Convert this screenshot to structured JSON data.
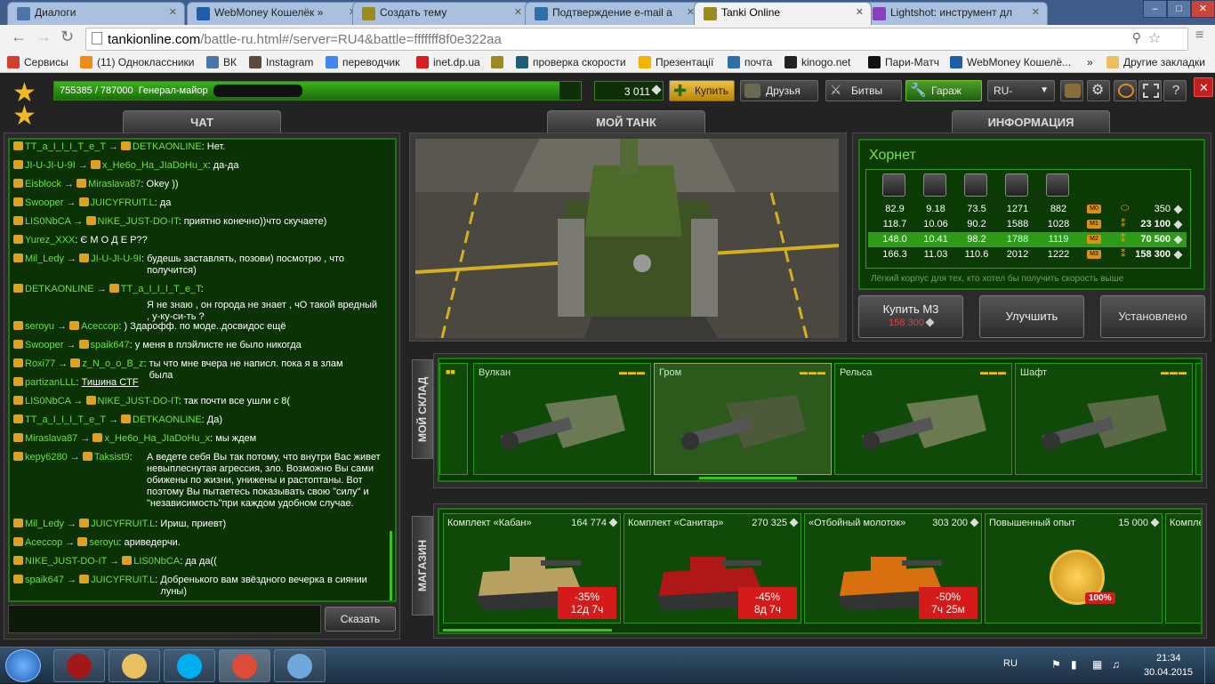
{
  "browser": {
    "tabs": [
      {
        "label": "Диалоги",
        "icon": "vk-icon",
        "color": "#4a76a8",
        "active": false
      },
      {
        "label": "WebMoney Кошелёк »",
        "icon": "webmoney-icon",
        "color": "#1e5ea8",
        "active": false
      },
      {
        "label": "Создать тему",
        "icon": "tanki-icon",
        "color": "#9a8a20",
        "active": false
      },
      {
        "label": "Подтверждение e-mail а",
        "icon": "mail-icon",
        "color": "#2f6fa8",
        "active": false
      },
      {
        "label": "Tanki Online",
        "icon": "tanki-icon",
        "color": "#9a8a20",
        "active": true
      },
      {
        "label": "Lightshot: инструмент дл",
        "icon": "lightshot-icon",
        "color": "#8a3fc0",
        "active": false
      }
    ],
    "url_prefix": "tankionline.com",
    "url_rest": "/battle-ru.html#/server=RU4&battle=fffffff8f0e322aa",
    "bookmarks": [
      {
        "label": "Сервисы",
        "icon": "apps-icon",
        "color": "#d23f31"
      },
      {
        "label": "(11) Одноклассники",
        "icon": "ok-icon",
        "color": "#f08a18"
      },
      {
        "label": "ВК",
        "icon": "vk-icon",
        "color": "#4a76a8"
      },
      {
        "label": "Instagram",
        "icon": "instagram-icon",
        "color": "#5b4a3a"
      },
      {
        "label": "переводчик",
        "icon": "translate-icon",
        "color": "#4285f4"
      },
      {
        "label": "inet.dp.ua",
        "icon": "star-icon",
        "color": "#d81e1e"
      },
      {
        "label": "",
        "icon": "tanki-icon",
        "color": "#9a8a20"
      },
      {
        "label": "проверка скорости",
        "icon": "speedtest-icon",
        "color": "#1e5e7a"
      },
      {
        "label": "Презентації",
        "icon": "slides-icon",
        "color": "#f2b400"
      },
      {
        "label": "почта",
        "icon": "mail-icon",
        "color": "#2f6fa8"
      },
      {
        "label": "kinogo.net",
        "icon": "kinogo-icon",
        "color": "#222222"
      },
      {
        "label": "Пари-Матч",
        "icon": "parimatch-icon",
        "color": "#111111"
      },
      {
        "label": "WebMoney Кошелё...",
        "icon": "webmoney-icon",
        "color": "#1e5ea8"
      },
      {
        "label": "»",
        "icon": "",
        "color": ""
      },
      {
        "label": "Другие закладки",
        "icon": "folder-icon",
        "color": "#e8c060"
      }
    ]
  },
  "game": {
    "top": {
      "progress_text": "755385 / 787000  Генерал-майор",
      "progress_fraction": 0.96,
      "crystals": "3 011",
      "buy_label": "Купить",
      "friends_label": "Друзья",
      "battles_label": "Битвы",
      "garage_label": "Гараж",
      "lang": "RU-"
    },
    "chat": {
      "title": "ЧАТ",
      "send_label": "Сказать",
      "messages": [
        {
          "from": "TT_a_I_I_I_T_e_T",
          "to": "DETKAONLINE",
          "text": "Нет."
        },
        {
          "from": "JI-U-JI-U-9I",
          "to": "x_He6o_Ha_JIaDoHu_x",
          "text": "да-да"
        },
        {
          "from": "Eisblock",
          "to": "Miraslava87",
          "text": "Okey ))"
        },
        {
          "from": "Swooper",
          "to": "JUICYFRUIT.L",
          "text": "да"
        },
        {
          "from": "LIS0NbCA",
          "to": "NIKE_JUST-DO-IT",
          "text": "приятно конечно))что скучаете)"
        },
        {
          "from": "Yurez_XXX",
          "to": "",
          "text": "Є М О Д Е Р??"
        },
        {
          "from": "Mil_Ledy",
          "to": "JI-U-JI-U-9I",
          "text": "будешь заставлять, позови) посмотрю , что получится)"
        },
        {
          "from": "DETKAONLINE",
          "to": "TT_a_I_I_I_T_e_T",
          "text": ""
        },
        {
          "from": "",
          "to": "",
          "text": "Я не знаю , он города не знает , чО такой вредный , у-ку-си-ть ?"
        },
        {
          "from": "seroyu",
          "to": "Acеccop",
          "text": ") Здарофф. по моде..досвидос ещё"
        },
        {
          "from": "Swooper",
          "to": "spaik647",
          "text": "у меня в плэйлисте не было никогда"
        },
        {
          "from": "Roxi77",
          "to": "z_N_o_o_B_z",
          "text": "ты что мне вчера не написл. пока я в злам была"
        },
        {
          "from": "partizanLLL",
          "to": "",
          "text": "Тишина CTF"
        },
        {
          "from": "LIS0NbCA",
          "to": "NIKE_JUST-DO-IT",
          "text": "так почти все ушли с 8("
        },
        {
          "from": "TT_a_I_I_I_T_e_T",
          "to": "DETKAONLINE",
          "text": "Да)"
        },
        {
          "from": "Miraslava87",
          "to": "x_He6o_Ha_JIaDoHu_x",
          "text": "мы ждем"
        },
        {
          "from": "kepy6280",
          "to": "Taksist9",
          "text": "А ведете себя Вы так потому, что внутри Вас живет невыплеснутая агрессия, зло. Возможно Вы сами обижены по жизни, унижены и растоптаны. Вот поэтому Вы пытаетесь показывать свою \"силу\" и \"независимость\"при каждом удобном случае."
        },
        {
          "from": "Mil_Ledy",
          "to": "JUICYFRUIT.L",
          "text": "Ириш, приевт)"
        },
        {
          "from": "Acеccop",
          "to": "seroyu",
          "text": "ариведерчи."
        },
        {
          "from": "NIKE_JUST-DO-IT",
          "to": "LIS0NbCA",
          "text": "да да(("
        },
        {
          "from": "spaik647",
          "to": "JUICYFRUIT.L",
          "text": "Добренького вам звёздного вечерка в сиянии луны)"
        }
      ]
    },
    "tank": {
      "title": "МОЙ ТАНК"
    },
    "info": {
      "title": "ИНФОРМАЦИЯ",
      "item_name": "Хорнет",
      "stat_icons": [
        "armor-icon",
        "speed-icon",
        "turn-icon",
        "weight-icon",
        "power-icon"
      ],
      "rows": [
        {
          "v": [
            "82.9",
            "9.18",
            "73.5",
            "1271",
            "882"
          ],
          "mod": "M0",
          "price": "350",
          "active": false
        },
        {
          "v": [
            "118.7",
            "10.06",
            "90.2",
            "1588",
            "1028"
          ],
          "mod": "M1",
          "price": "23 100",
          "active": false
        },
        {
          "v": [
            "148.0",
            "10.41",
            "98.2",
            "1788",
            "1119"
          ],
          "mod": "M2",
          "price": "70 500",
          "active": true
        },
        {
          "v": [
            "166.3",
            "11.03",
            "110.6",
            "2012",
            "1222"
          ],
          "mod": "M3",
          "price": "158 300",
          "active": false
        }
      ],
      "description": "Лёгкий корпус для тех, кто хотел бы получить скорость выше",
      "buy_label": "Купить M3",
      "buy_price": "158 300",
      "upgrade_label": "Улучшить",
      "installed_label": "Установлено"
    },
    "garage": {
      "label": "МОЙ СКЛАД",
      "items": [
        {
          "name": "Вулкан",
          "color": "#6b7a55"
        },
        {
          "name": "Гром",
          "color": "#4d5a3a"
        },
        {
          "name": "Рельса",
          "color": "#6c7a52"
        },
        {
          "name": "Шафт",
          "color": "#5a6a45"
        }
      ]
    },
    "shop": {
      "label": "МАГАЗИН",
      "items": [
        {
          "name": "Комплект «Кабан»",
          "price": "164 774",
          "disc": "-35%",
          "time": "12д 7ч",
          "color": "#b8a060"
        },
        {
          "name": "Комплект «Санитар»",
          "price": "270 325",
          "disc": "-45%",
          "time": "8д 7ч",
          "color": "#b01818"
        },
        {
          "name": "«Отбойный молоток»",
          "price": "303 200",
          "disc": "-50%",
          "time": "7ч 25м",
          "color": "#d87010"
        },
        {
          "name": "Повышенный опыт",
          "price": "15 000",
          "disc": "",
          "time": "",
          "badge": "100%",
          "color": "#e0a010"
        },
        {
          "name": "Компле",
          "price": "",
          "disc": "",
          "time": "",
          "color": "#0f4a08"
        }
      ]
    }
  },
  "taskbar": {
    "apps": [
      "tankionline-icon",
      "explorer-icon",
      "skype-icon",
      "chrome-icon",
      "paint-icon"
    ],
    "lang": "RU",
    "time": "21:34",
    "date": "30.04.2015"
  }
}
